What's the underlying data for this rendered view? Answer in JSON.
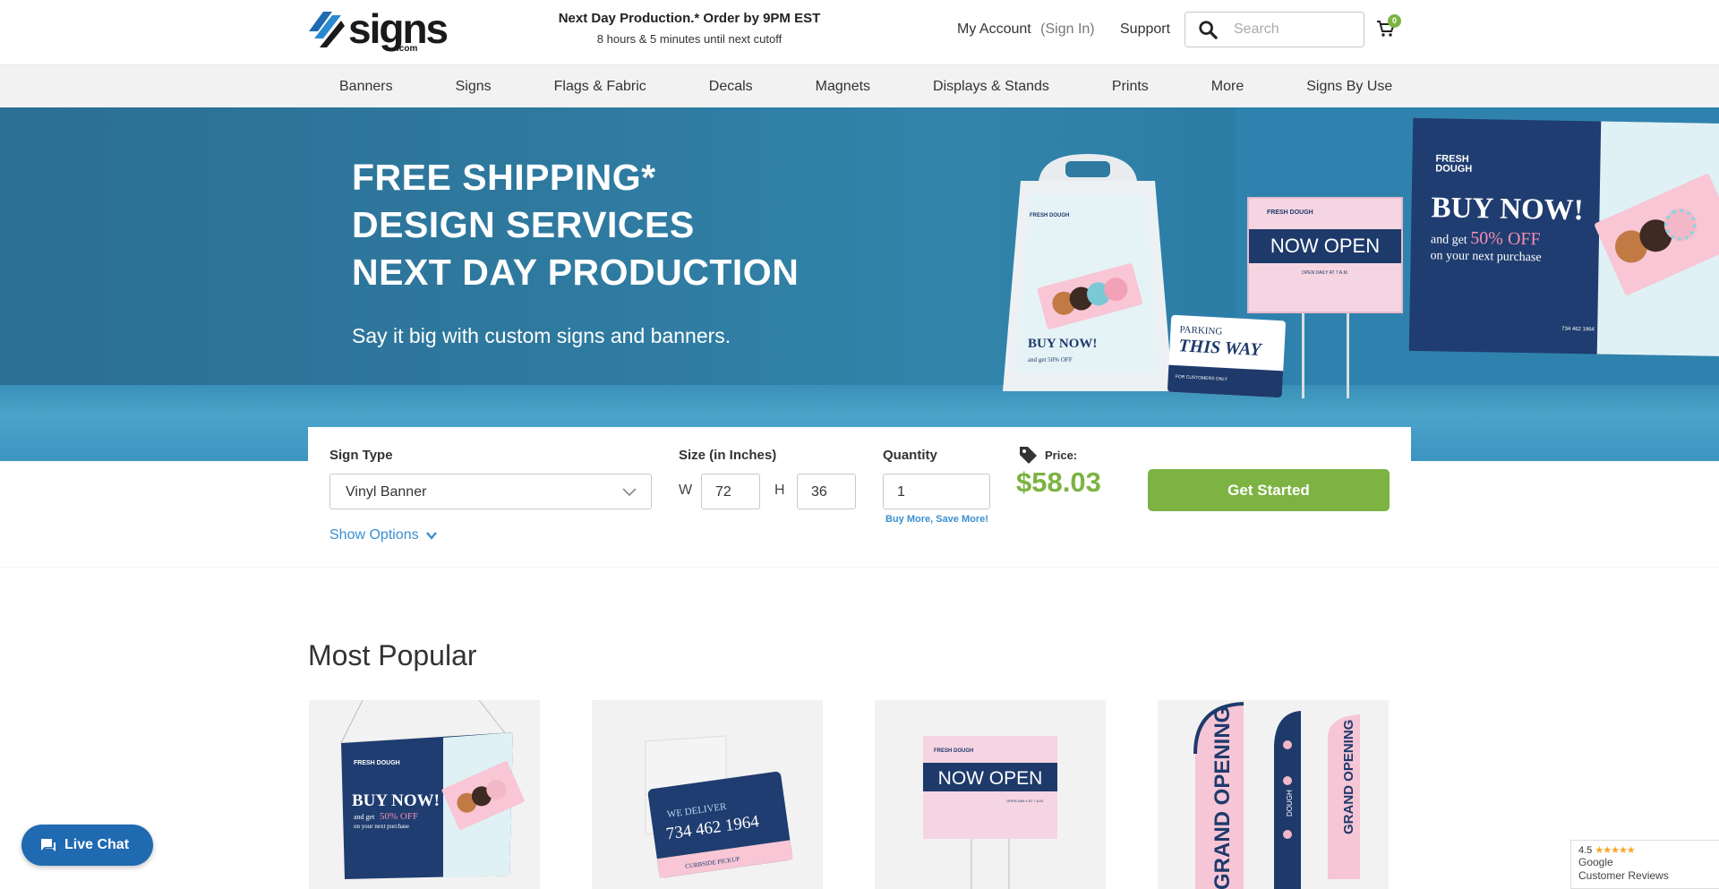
{
  "header": {
    "logo_text": "signs",
    "logo_suffix": ".com",
    "promo_title": "Next Day Production.* Order by 9PM EST",
    "promo_countdown": "8 hours & 5 minutes until next cutoff",
    "account_label": "My Account",
    "signin_label": "(Sign In)",
    "support_label": "Support",
    "search_placeholder": "Search",
    "cart_count": "0"
  },
  "nav": {
    "items": [
      {
        "label": "Banners"
      },
      {
        "label": "Signs"
      },
      {
        "label": "Flags & Fabric"
      },
      {
        "label": "Decals"
      },
      {
        "label": "Magnets"
      },
      {
        "label": "Displays & Stands"
      },
      {
        "label": "Prints"
      },
      {
        "label": "More"
      },
      {
        "label": "Signs By Use"
      }
    ]
  },
  "hero": {
    "headline": [
      "FREE SHIPPING*",
      "DESIGN SERVICES",
      "NEXT DAY PRODUCTION"
    ],
    "subheadline": "Say it big with custom signs and banners.",
    "aframe": {
      "brand": "FRESH DOUGH",
      "title": "BUY NOW!",
      "offer": "and get 50% OFF"
    },
    "yard_sign": {
      "brand": "FRESH DOUGH",
      "title": "NOW OPEN",
      "hours": "OPEN DAILY AT 7 A.M."
    },
    "parking_sign": {
      "line1": "PARKING",
      "line2": "THIS WAY",
      "footer": "FOR CUSTOMERS ONLY"
    },
    "banner": {
      "brand_line1": "FRESH",
      "brand_line2": "DOUGH",
      "title": "BUY NOW!",
      "offer_prefix": "and get",
      "offer_highlight": "50% OFF",
      "offer_suffix": "on your next purchase",
      "contact": "734 462 1964"
    }
  },
  "configurator": {
    "sign_type_label": "Sign Type",
    "sign_type_value": "Vinyl Banner",
    "show_options_label": "Show Options",
    "size_label": "Size (in Inches)",
    "width_label": "W",
    "width_value": "72",
    "height_label": "H",
    "height_value": "36",
    "quantity_label": "Quantity",
    "quantity_value": "1",
    "save_more_label": "Buy More, Save More!",
    "price_label": "Price:",
    "price_value": "$58.03",
    "cta_label": "Get Started"
  },
  "most_popular": {
    "title": "Most Popular",
    "cards": [
      {
        "brand": "FRESH DOUGH",
        "title": "BUY NOW!",
        "offer_prefix": "and get",
        "offer_highlight": "50% OFF",
        "offer_suffix": "on your next purchase"
      },
      {
        "line1": "WE DELIVER",
        "line2": "734 462 1964",
        "footer": "CURBSIDE PICKUP"
      },
      {
        "brand": "FRESH DOUGH",
        "title": "NOW OPEN",
        "hours": "OPEN DAILY AT 7 A.M."
      },
      {
        "flag1": "GRAND OPENING",
        "flag2": "DOUGH",
        "flag3": "GRAND OPENING"
      }
    ]
  },
  "live_chat": {
    "label": "Live Chat"
  },
  "reviews": {
    "score": "4.5",
    "stars": "★★★★★",
    "line1": "Google",
    "line2": "Customer Reviews"
  },
  "colors": {
    "brand_blue": "#1f6ab0",
    "accent_green": "#7cb342",
    "link_blue": "#3a8fd0",
    "nav_bg": "#f2f2f2",
    "hero_blue": "#2f7aa0",
    "navy": "#1e3a6b",
    "pink": "#f6d5e2"
  }
}
